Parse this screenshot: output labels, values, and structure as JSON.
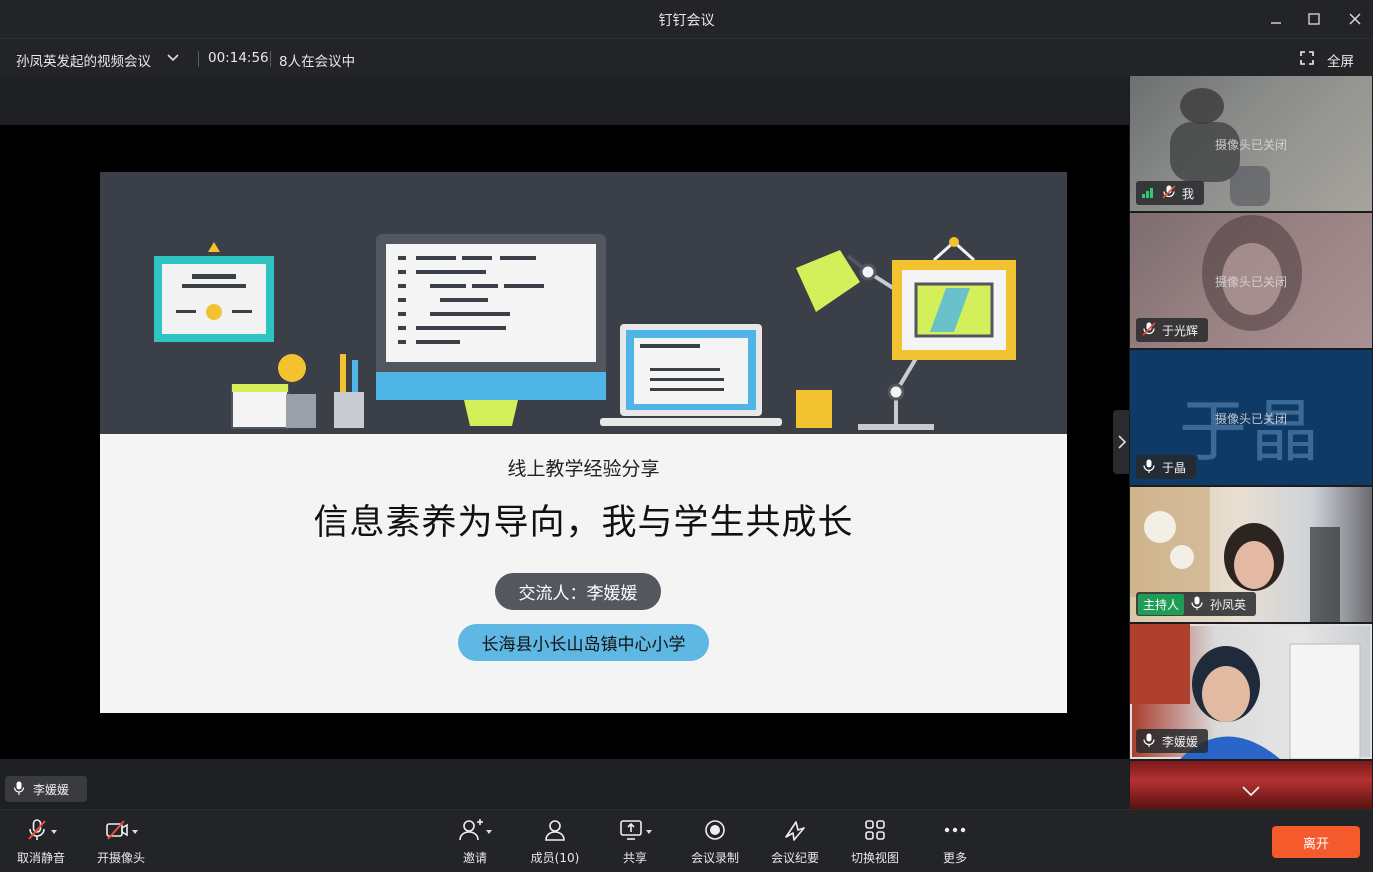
{
  "window": {
    "title": "钉钉会议",
    "minimize_icon": "minimize-icon",
    "maximize_icon": "maximize-icon",
    "close_icon": "close-icon"
  },
  "infobar": {
    "meeting_name": "孙凤英发起的视频会议",
    "duration": "00:14:56",
    "participants_text": "8人在会议中",
    "fullscreen_label": "全屏"
  },
  "slide": {
    "subtitle": "线上教学经验分享",
    "headline": "信息素养为导向，我与学生共成长",
    "presenter": "交流人：李媛媛",
    "school": "长海县小长山岛镇中心小学"
  },
  "active_speaker": {
    "name": "李媛媛"
  },
  "participants": [
    {
      "name": "我",
      "status": "摄像头已关闭",
      "mic": "muted",
      "signal": true
    },
    {
      "name": "于光辉",
      "status": "摄像头已关闭",
      "mic": "muted"
    },
    {
      "name": "于晶",
      "status": "摄像头已关闭",
      "mic": "on",
      "avatar_text": "于晶"
    },
    {
      "name": "孙凤英",
      "badge": "主持人",
      "mic": "on"
    },
    {
      "name": "李媛媛",
      "mic": "on"
    }
  ],
  "toolbar": {
    "unmute": "取消静音",
    "camera_on": "开摄像头",
    "invite": "邀请",
    "members": "成员(10)",
    "share": "共享",
    "record": "会议录制",
    "minutes": "会议纪要",
    "switch_view": "切换视图",
    "more": "更多",
    "leave": "离开"
  },
  "colors": {
    "leave_button": "#f55a2c",
    "host_badge": "#1f9d55",
    "slide_header": "#3b3f47",
    "pill_blue": "#5fb8e3"
  }
}
